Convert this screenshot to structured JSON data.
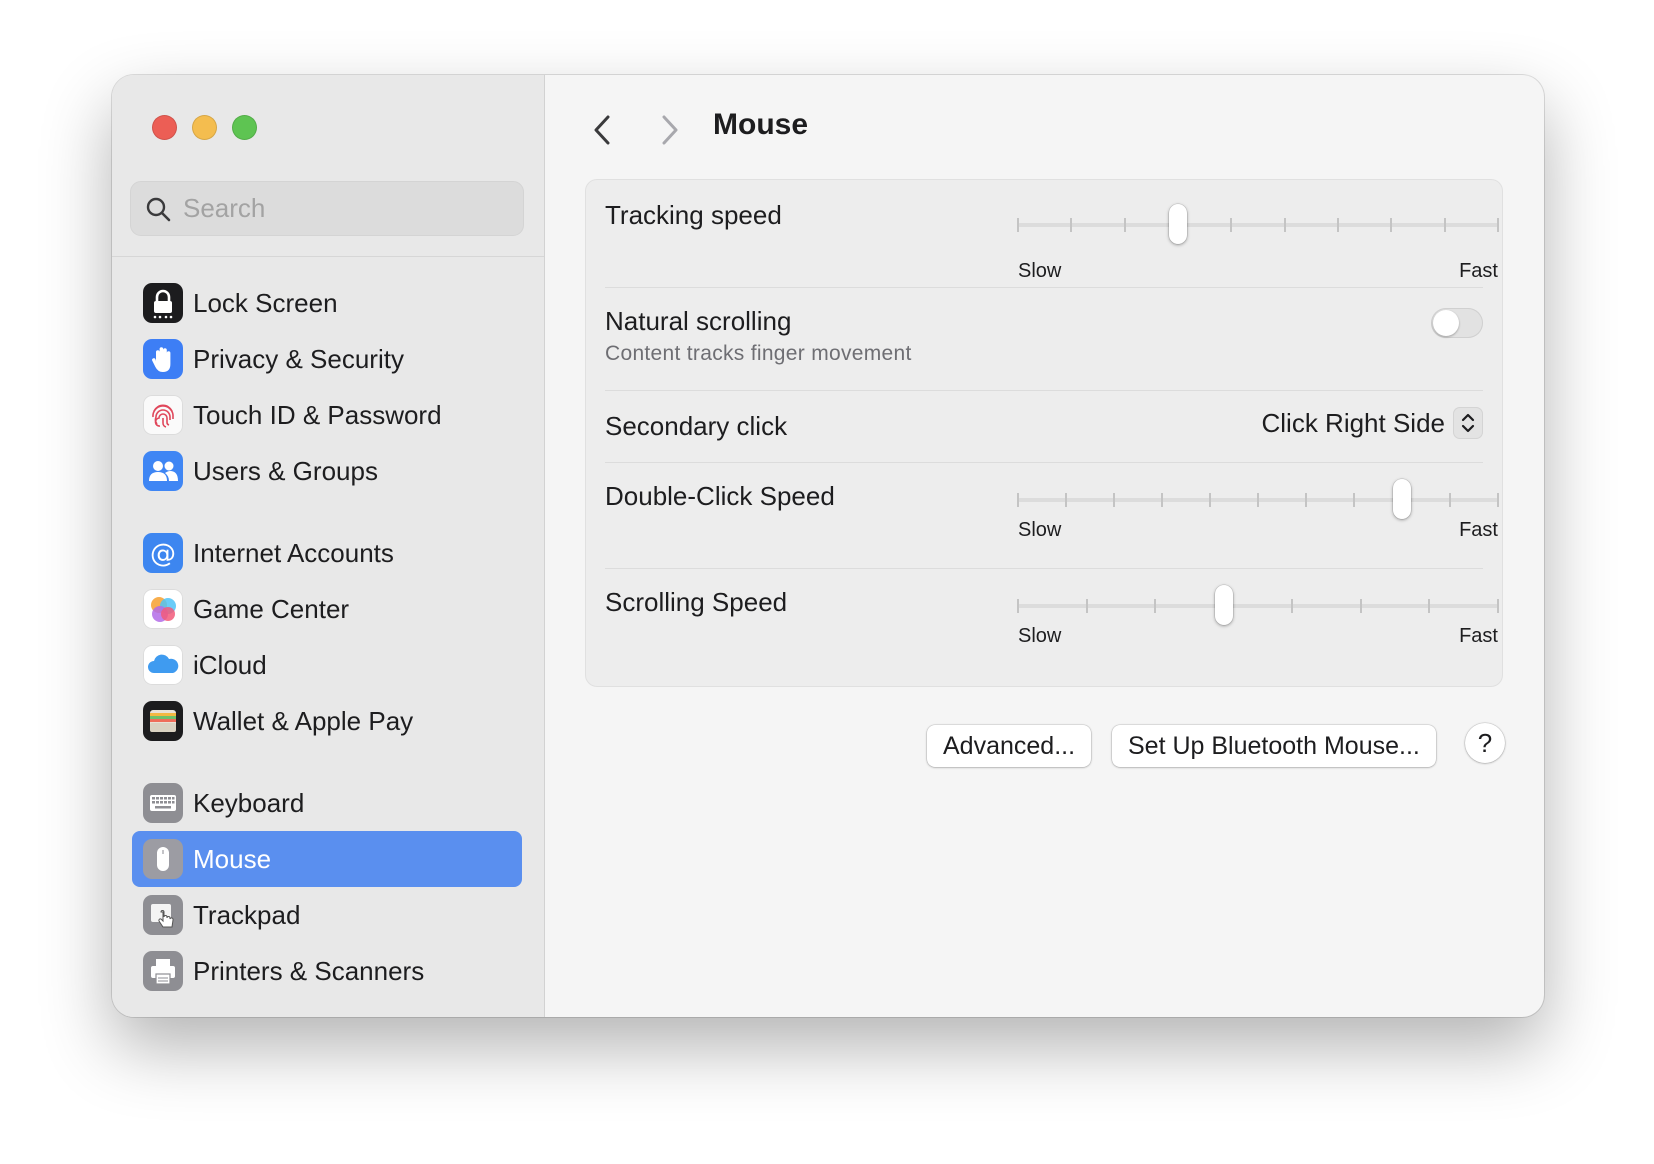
{
  "window": {
    "traffic_lights": [
      "close",
      "minimize",
      "zoom"
    ]
  },
  "sidebar": {
    "search": {
      "placeholder": "Search",
      "value": ""
    },
    "groups": [
      [
        {
          "label": "Lock Screen",
          "icon": "lock-icon"
        },
        {
          "label": "Privacy & Security",
          "icon": "hand-icon"
        },
        {
          "label": "Touch ID & Password",
          "icon": "fingerprint-icon"
        },
        {
          "label": "Users & Groups",
          "icon": "users-icon"
        }
      ],
      [
        {
          "label": "Internet Accounts",
          "icon": "at-sign-icon"
        },
        {
          "label": "Game Center",
          "icon": "game-center-icon"
        },
        {
          "label": "iCloud",
          "icon": "cloud-icon"
        },
        {
          "label": "Wallet & Apple Pay",
          "icon": "wallet-icon"
        }
      ],
      [
        {
          "label": "Keyboard",
          "icon": "keyboard-icon"
        },
        {
          "label": "Mouse",
          "icon": "mouse-icon",
          "selected": true
        },
        {
          "label": "Trackpad",
          "icon": "trackpad-icon"
        },
        {
          "label": "Printers & Scanners",
          "icon": "printer-icon"
        }
      ]
    ],
    "selected_color": "#5a8fef"
  },
  "main": {
    "title": "Mouse",
    "settings": {
      "tracking_speed": {
        "label": "Tracking speed",
        "min_label": "Slow",
        "max_label": "Fast",
        "ticks": 10,
        "position": 3
      },
      "natural_scrolling": {
        "label": "Natural scrolling",
        "description": "Content tracks finger movement",
        "enabled": false
      },
      "secondary_click": {
        "label": "Secondary click",
        "value": "Click Right Side"
      },
      "double_click_speed": {
        "label": "Double-Click Speed",
        "min_label": "Slow",
        "max_label": "Fast",
        "ticks": 11,
        "position": 8
      },
      "scrolling_speed": {
        "label": "Scrolling Speed",
        "min_label": "Slow",
        "max_label": "Fast",
        "ticks": 8,
        "position": 3
      }
    },
    "buttons": {
      "advanced": "Advanced...",
      "bluetooth": "Set Up Bluetooth Mouse...",
      "help": "?"
    }
  }
}
